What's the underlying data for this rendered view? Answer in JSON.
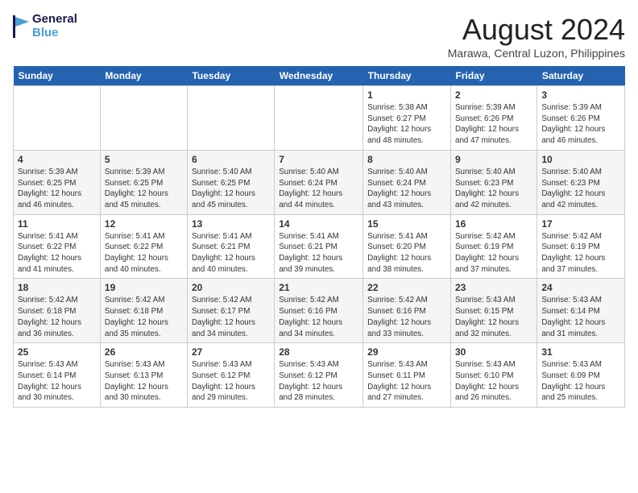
{
  "logo": {
    "general": "General",
    "blue": "Blue"
  },
  "title": {
    "month_year": "August 2024",
    "location": "Marawa, Central Luzon, Philippines"
  },
  "weekdays": [
    "Sunday",
    "Monday",
    "Tuesday",
    "Wednesday",
    "Thursday",
    "Friday",
    "Saturday"
  ],
  "weeks": [
    [
      {
        "day": "",
        "info": ""
      },
      {
        "day": "",
        "info": ""
      },
      {
        "day": "",
        "info": ""
      },
      {
        "day": "",
        "info": ""
      },
      {
        "day": "1",
        "info": "Sunrise: 5:38 AM\nSunset: 6:27 PM\nDaylight: 12 hours\nand 48 minutes."
      },
      {
        "day": "2",
        "info": "Sunrise: 5:39 AM\nSunset: 6:26 PM\nDaylight: 12 hours\nand 47 minutes."
      },
      {
        "day": "3",
        "info": "Sunrise: 5:39 AM\nSunset: 6:26 PM\nDaylight: 12 hours\nand 46 minutes."
      }
    ],
    [
      {
        "day": "4",
        "info": "Sunrise: 5:39 AM\nSunset: 6:25 PM\nDaylight: 12 hours\nand 46 minutes."
      },
      {
        "day": "5",
        "info": "Sunrise: 5:39 AM\nSunset: 6:25 PM\nDaylight: 12 hours\nand 45 minutes."
      },
      {
        "day": "6",
        "info": "Sunrise: 5:40 AM\nSunset: 6:25 PM\nDaylight: 12 hours\nand 45 minutes."
      },
      {
        "day": "7",
        "info": "Sunrise: 5:40 AM\nSunset: 6:24 PM\nDaylight: 12 hours\nand 44 minutes."
      },
      {
        "day": "8",
        "info": "Sunrise: 5:40 AM\nSunset: 6:24 PM\nDaylight: 12 hours\nand 43 minutes."
      },
      {
        "day": "9",
        "info": "Sunrise: 5:40 AM\nSunset: 6:23 PM\nDaylight: 12 hours\nand 42 minutes."
      },
      {
        "day": "10",
        "info": "Sunrise: 5:40 AM\nSunset: 6:23 PM\nDaylight: 12 hours\nand 42 minutes."
      }
    ],
    [
      {
        "day": "11",
        "info": "Sunrise: 5:41 AM\nSunset: 6:22 PM\nDaylight: 12 hours\nand 41 minutes."
      },
      {
        "day": "12",
        "info": "Sunrise: 5:41 AM\nSunset: 6:22 PM\nDaylight: 12 hours\nand 40 minutes."
      },
      {
        "day": "13",
        "info": "Sunrise: 5:41 AM\nSunset: 6:21 PM\nDaylight: 12 hours\nand 40 minutes."
      },
      {
        "day": "14",
        "info": "Sunrise: 5:41 AM\nSunset: 6:21 PM\nDaylight: 12 hours\nand 39 minutes."
      },
      {
        "day": "15",
        "info": "Sunrise: 5:41 AM\nSunset: 6:20 PM\nDaylight: 12 hours\nand 38 minutes."
      },
      {
        "day": "16",
        "info": "Sunrise: 5:42 AM\nSunset: 6:19 PM\nDaylight: 12 hours\nand 37 minutes."
      },
      {
        "day": "17",
        "info": "Sunrise: 5:42 AM\nSunset: 6:19 PM\nDaylight: 12 hours\nand 37 minutes."
      }
    ],
    [
      {
        "day": "18",
        "info": "Sunrise: 5:42 AM\nSunset: 6:18 PM\nDaylight: 12 hours\nand 36 minutes."
      },
      {
        "day": "19",
        "info": "Sunrise: 5:42 AM\nSunset: 6:18 PM\nDaylight: 12 hours\nand 35 minutes."
      },
      {
        "day": "20",
        "info": "Sunrise: 5:42 AM\nSunset: 6:17 PM\nDaylight: 12 hours\nand 34 minutes."
      },
      {
        "day": "21",
        "info": "Sunrise: 5:42 AM\nSunset: 6:16 PM\nDaylight: 12 hours\nand 34 minutes."
      },
      {
        "day": "22",
        "info": "Sunrise: 5:42 AM\nSunset: 6:16 PM\nDaylight: 12 hours\nand 33 minutes."
      },
      {
        "day": "23",
        "info": "Sunrise: 5:43 AM\nSunset: 6:15 PM\nDaylight: 12 hours\nand 32 minutes."
      },
      {
        "day": "24",
        "info": "Sunrise: 5:43 AM\nSunset: 6:14 PM\nDaylight: 12 hours\nand 31 minutes."
      }
    ],
    [
      {
        "day": "25",
        "info": "Sunrise: 5:43 AM\nSunset: 6:14 PM\nDaylight: 12 hours\nand 30 minutes."
      },
      {
        "day": "26",
        "info": "Sunrise: 5:43 AM\nSunset: 6:13 PM\nDaylight: 12 hours\nand 30 minutes."
      },
      {
        "day": "27",
        "info": "Sunrise: 5:43 AM\nSunset: 6:12 PM\nDaylight: 12 hours\nand 29 minutes."
      },
      {
        "day": "28",
        "info": "Sunrise: 5:43 AM\nSunset: 6:12 PM\nDaylight: 12 hours\nand 28 minutes."
      },
      {
        "day": "29",
        "info": "Sunrise: 5:43 AM\nSunset: 6:11 PM\nDaylight: 12 hours\nand 27 minutes."
      },
      {
        "day": "30",
        "info": "Sunrise: 5:43 AM\nSunset: 6:10 PM\nDaylight: 12 hours\nand 26 minutes."
      },
      {
        "day": "31",
        "info": "Sunrise: 5:43 AM\nSunset: 6:09 PM\nDaylight: 12 hours\nand 25 minutes."
      }
    ]
  ]
}
